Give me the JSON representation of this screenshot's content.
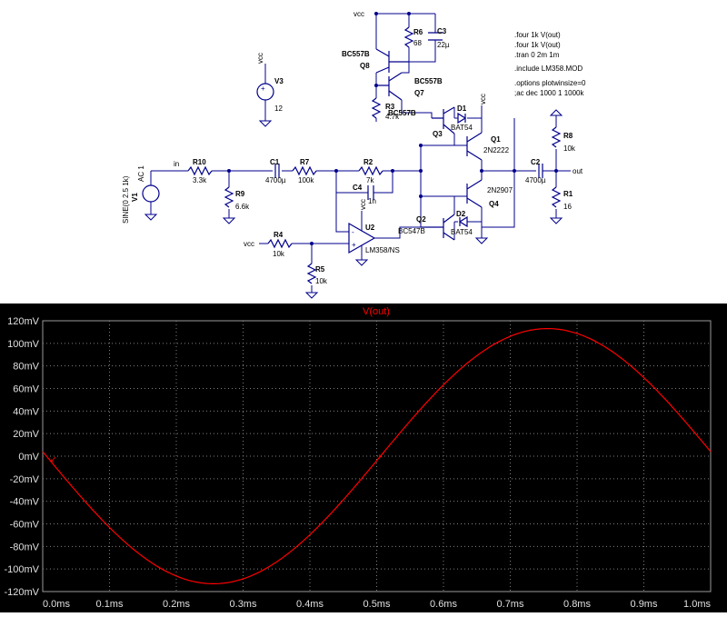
{
  "schematic": {
    "directives": [
      ".four 1k V(out)",
      ".four 1k V(out)",
      ".tran 0 2m 1m",
      ".include LM358.MOD",
      ".options plotwinsize=0",
      ";ac dec 1000 1 1000k"
    ],
    "nets": {
      "vcc": "vcc",
      "in": "in",
      "out": "out"
    },
    "components": {
      "V1": {
        "name": "V1",
        "value": "SINE(0 2.5 1k)",
        "ac": "AC 1"
      },
      "V3": {
        "name": "V3",
        "value": "12"
      },
      "R10": {
        "name": "R10",
        "value": "3.3k"
      },
      "R9": {
        "name": "R9",
        "value": "6.6k"
      },
      "C1": {
        "name": "C1",
        "value": "4700µ"
      },
      "R7": {
        "name": "R7",
        "value": "100k"
      },
      "R2": {
        "name": "R2",
        "value": "7k"
      },
      "C4": {
        "name": "C4",
        "value": "1n"
      },
      "R4": {
        "name": "R4",
        "value": "10k"
      },
      "R5": {
        "name": "R5",
        "value": "10k"
      },
      "U2": {
        "name": "U2",
        "value": "LM358/NS"
      },
      "R6": {
        "name": "R6",
        "value": "68"
      },
      "C3": {
        "name": "C3",
        "value": "22µ"
      },
      "Q8": {
        "name": "Q8",
        "value": "BC557B"
      },
      "Q7": {
        "name": "Q7",
        "value": "BC557B"
      },
      "R3": {
        "name": "R3",
        "value": "4.7k"
      },
      "Q3": {
        "name": "Q3",
        "value": "BC557B"
      },
      "D1": {
        "name": "D1",
        "value": "BAT54"
      },
      "Q1": {
        "name": "Q1",
        "value": "2N2222"
      },
      "Q2": {
        "name": "Q2",
        "value": "BC547B"
      },
      "D2": {
        "name": "D2",
        "value": "BAT54"
      },
      "Q4": {
        "name": "Q4",
        "value": "2N2907"
      },
      "C2": {
        "name": "C2",
        "value": "4700µ"
      },
      "R8": {
        "name": "R8",
        "value": "10k"
      },
      "R1": {
        "name": "R1",
        "value": "16"
      }
    }
  },
  "plot": {
    "title": "V(out)",
    "trace_color": "#ff0000",
    "background": "#000000",
    "grid_color": "#808080",
    "cursor_marker": "↙"
  },
  "chart_data": {
    "type": "line",
    "title": "V(out)",
    "xlabel": "",
    "ylabel": "",
    "xlim": [
      0.0,
      1.0
    ],
    "ylim": [
      -120,
      120
    ],
    "x_unit": "ms",
    "y_unit": "mV",
    "x_ticks": [
      "0.0ms",
      "0.1ms",
      "0.2ms",
      "0.3ms",
      "0.4ms",
      "0.5ms",
      "0.6ms",
      "0.7ms",
      "0.8ms",
      "0.9ms",
      "1.0ms"
    ],
    "y_ticks": [
      "120mV",
      "100mV",
      "80mV",
      "60mV",
      "40mV",
      "20mV",
      "0mV",
      "-20mV",
      "-40mV",
      "-60mV",
      "-80mV",
      "-100mV",
      "-120mV"
    ],
    "grid": true,
    "series": [
      {
        "name": "V(out)",
        "x": [
          0.0,
          0.05,
          0.1,
          0.15,
          0.2,
          0.26,
          0.3,
          0.35,
          0.4,
          0.45,
          0.5,
          0.55,
          0.6,
          0.65,
          0.7,
          0.76,
          0.8,
          0.85,
          0.9,
          0.95,
          1.0
        ],
        "y": [
          0,
          -35,
          -67,
          -92,
          -108,
          -113,
          -108,
          -92,
          -67,
          -35,
          0,
          35,
          67,
          92,
          108,
          113,
          108,
          92,
          67,
          35,
          0
        ]
      }
    ]
  }
}
